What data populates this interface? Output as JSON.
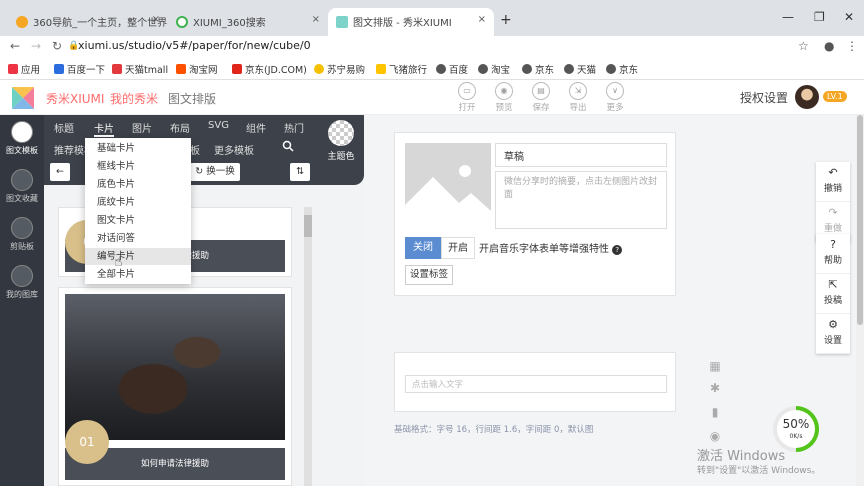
{
  "browser": {
    "tabs": [
      {
        "title": "360导航_一个主页，整个世界"
      },
      {
        "title": "XIUMI_360搜索"
      },
      {
        "title": "图文排版 - 秀米XIUMI"
      }
    ],
    "new_tab": "+",
    "url": "xiumi.us/studio/v5#/paper/for/new/cube/0",
    "bookmarks": [
      "应用",
      "百度一下",
      "天猫tmall",
      "淘宝网",
      "京东(JD.COM)",
      "苏宁易购",
      "飞猪旅行",
      "百度",
      "淘宝",
      "京东",
      "天猫",
      "京东"
    ]
  },
  "header": {
    "brand": "秀米XIUMI",
    "my_xiumi": "我的秀米",
    "page": "图文排版",
    "tools": [
      "打开",
      "预览",
      "保存",
      "导出",
      "更多"
    ],
    "auth": "授权设置",
    "level": "LV.1"
  },
  "leftnav": {
    "items": [
      "图文模板",
      "图文收藏",
      "剪贴板",
      "我的图库"
    ]
  },
  "panel": {
    "tabs": [
      "标题",
      "卡片",
      "图片",
      "布局",
      "SVG",
      "组件",
      "热门"
    ],
    "row2": [
      "推荐模板",
      "板",
      "更多模板"
    ],
    "theme_label": "主题色",
    "swap_label": "换一换",
    "dropdown": [
      "基础卡片",
      "框线卡片",
      "底色卡片",
      "底纹卡片",
      "图文卡片",
      "对话问答",
      "编号卡片",
      "全部卡片"
    ],
    "cards": [
      {
        "num": "0",
        "text": "如何申请法律援助"
      },
      {
        "num": "01",
        "text": "如何申请法律援助"
      }
    ]
  },
  "editor": {
    "title_value": "草稿",
    "summary_placeholder": "微信分享时的摘要，点击左侧图片改封面",
    "off": "关闭",
    "on": "开启",
    "note": "开启音乐字体表单等增强特性",
    "q": "?",
    "tag_button": "设置标签",
    "text_placeholder": "点击输入文字",
    "format_info": "基础格式：字号 16，行间距 1.6，字间距 0，默认图"
  },
  "right_toolbar": [
    "撤销",
    "重做",
    "帮助",
    "投稿",
    "设置"
  ],
  "gauge": {
    "percent": 50,
    "percent_label": "50%",
    "speed": "0K/s"
  },
  "watermark": {
    "line1": "激活 Windows",
    "line2": "转到\"设置\"以激活 Windows。"
  },
  "colors": {
    "brand": "#ff6b6b",
    "panel_dark": "#3d424a",
    "nav_dark": "#333840",
    "gauge": "#52c41a"
  }
}
